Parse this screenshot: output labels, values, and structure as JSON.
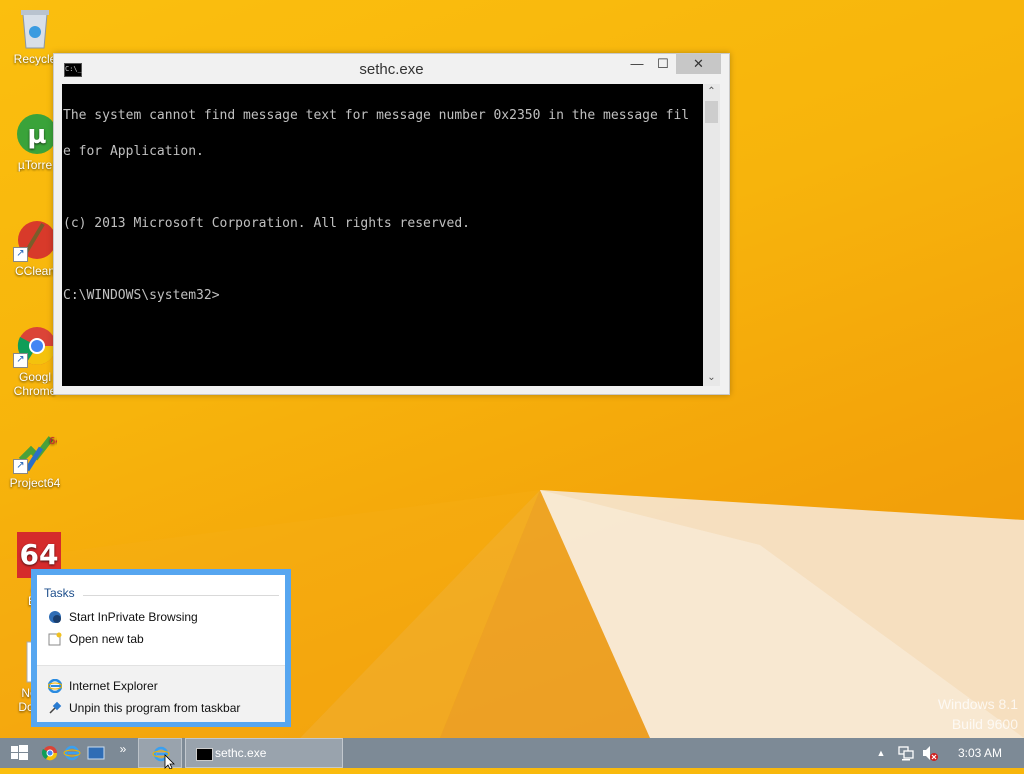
{
  "desktop": {
    "icons": [
      {
        "label": "Recycle",
        "icon": "recycle-bin-icon"
      },
      {
        "label": "µTorre",
        "icon": "utorrent-icon"
      },
      {
        "label": "CClean",
        "icon": "ccleaner-icon"
      },
      {
        "label": "Googl",
        "label2": "Chrome",
        "icon": "chrome-icon"
      },
      {
        "label": "Project64",
        "icon": "project64-icon"
      },
      {
        "label": "A",
        "label2": "Ex",
        "icon": "aida64-icon"
      },
      {
        "label": "Ne",
        "label2": "Doc",
        "icon": "document-icon"
      }
    ],
    "watermark": {
      "line1": "Windows 8.1",
      "line2": "Build 9600"
    }
  },
  "console_window": {
    "title": "sethc.exe",
    "icon_text": "C:\\_",
    "controls": {
      "minimize": "—",
      "maximize": "☐",
      "close": "✕"
    },
    "lines": [
      "The system cannot find message text for message number 0x2350 in the message fil",
      "e for Application.",
      "",
      "(c) 2013 Microsoft Corporation. All rights reserved.",
      "",
      "C:\\WINDOWS\\system32>"
    ]
  },
  "jump_list": {
    "header": "Tasks",
    "tasks": [
      {
        "label": "Start InPrivate Browsing",
        "icon": "inprivate-icon"
      },
      {
        "label": "Open new tab",
        "icon": "new-tab-icon"
      }
    ],
    "program": {
      "label": "Internet Explorer",
      "icon": "internet-explorer-icon"
    },
    "unpin": {
      "label": "Unpin this program from taskbar",
      "icon": "unpin-icon"
    }
  },
  "taskbar": {
    "chevron": "»",
    "active_window": "sethc.exe",
    "tray_arrow": "▲",
    "clock": "3:03 AM"
  },
  "colors": {
    "accent": "#56a6f0",
    "taskbar": "#7d8a96",
    "desktop": "#f7b40c"
  }
}
